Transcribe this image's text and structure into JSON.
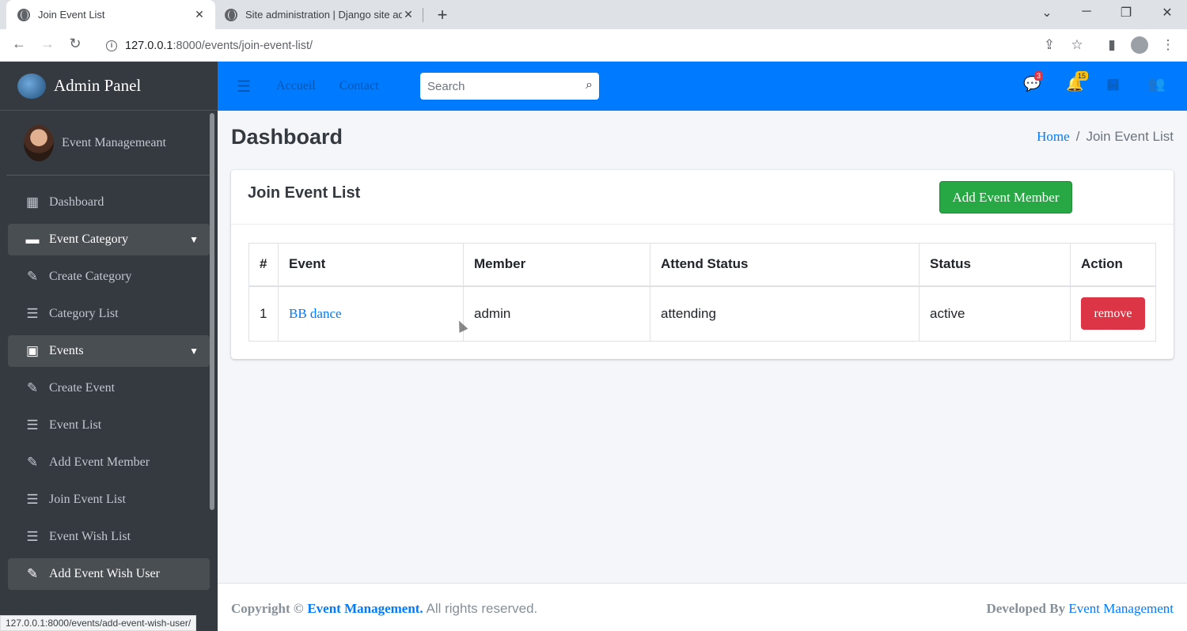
{
  "browser": {
    "tabs": [
      {
        "title": "Join Event List",
        "active": true
      },
      {
        "title": "Site administration | Django site admin",
        "active": false
      }
    ],
    "url_host": "127.0.0.1",
    "url_path": ":8000/events/join-event-list/",
    "status_url": "127.0.0.1:8000/events/add-event-wish-user/"
  },
  "sidebar": {
    "brand": "Admin Panel",
    "user": "Event Managemeant",
    "items": [
      {
        "label": "Dashboard",
        "icon": "grid-icon"
      },
      {
        "label": "Event Category",
        "icon": "folder-icon"
      },
      {
        "label": "Create Category",
        "icon": "edit-icon"
      },
      {
        "label": "Category List",
        "icon": "list-icon"
      },
      {
        "label": "Events",
        "icon": "calendar-icon"
      },
      {
        "label": "Create Event",
        "icon": "edit-icon"
      },
      {
        "label": "Event List",
        "icon": "list-icon"
      },
      {
        "label": "Add Event Member",
        "icon": "edit-icon"
      },
      {
        "label": "Join Event List",
        "icon": "list-icon"
      },
      {
        "label": "Event Wish List",
        "icon": "list-icon"
      },
      {
        "label": "Add Event Wish User",
        "icon": "edit-icon"
      }
    ]
  },
  "topnav": {
    "links": [
      "Accueil",
      "Contact"
    ],
    "search_placeholder": "Search",
    "messages_count": "3",
    "notifications_count": "15"
  },
  "content": {
    "title": "Dashboard",
    "breadcrumb_home": "Home",
    "breadcrumb_sep": "/",
    "breadcrumb_current": "Join Event List"
  },
  "card": {
    "title": "Join Event List",
    "add_button": "Add Event Member",
    "columns": [
      "#",
      "Event",
      "Member",
      "Attend Status",
      "Status",
      "Action"
    ],
    "rows": [
      {
        "num": "1",
        "event": "BB dance",
        "member": "admin",
        "attend_status": "attending",
        "status": "active",
        "action": "remove"
      }
    ]
  },
  "footer": {
    "copyright_prefix": "Copyright ©",
    "brand_link": "Event Management.",
    "rights": "All rights reserved.",
    "developed_by": "Developed By",
    "developer_link": "Event Management"
  }
}
